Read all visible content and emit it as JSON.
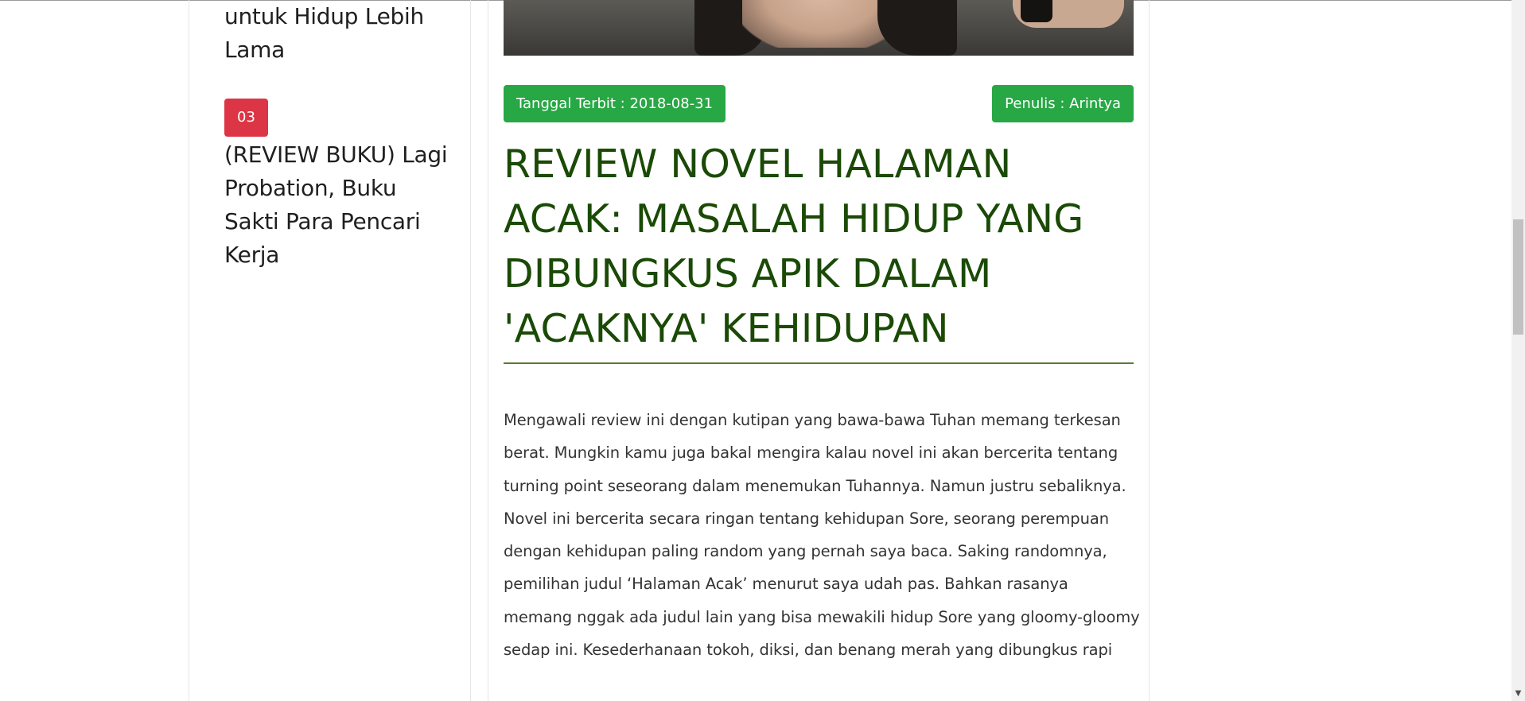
{
  "sidebar": {
    "prev_item_tail_line1": "untuk Hidup Lebih",
    "prev_item_tail_line2": "Lama",
    "item": {
      "rank": "03",
      "title": "(REVIEW BUKU) Lagi Probation, Buku Sakti Para Pencari Kerja"
    }
  },
  "article": {
    "date_label": "Tanggal Terbit : 2018-08-31",
    "author_label": "Penulis : Arintya",
    "title": "REVIEW NOVEL HALAMAN ACAK: MASALAH HIDUP YANG DIBUNGKUS APIK DALAM 'ACAKNYA' KEHIDUPAN",
    "body": "Mengawali review ini dengan kutipan yang bawa-bawa Tuhan memang terkesan berat. Mungkin kamu juga bakal mengira kalau novel ini akan bercerita tentang turning point seseorang dalam menemukan Tuhannya. Namun justru sebaliknya. Novel ini bercerita secara ringan tentang kehidupan Sore, seorang perempuan dengan kehidupan paling random yang pernah saya baca. Saking randomnya, pemilihan judul ‘Halaman Acak’ menurut saya udah pas. Bahkan rasanya memang nggak ada judul lain yang bisa mewakili hidup Sore yang gloomy-gloomy sedap ini. Kesederhanaan tokoh, diksi, dan benang merah yang dibungkus rapi"
  },
  "colors": {
    "badge_green": "#28a745",
    "rank_red": "#dc3545",
    "title_green": "#1a4a05"
  },
  "scrollbar": {
    "down_arrow_icon": "▼"
  }
}
